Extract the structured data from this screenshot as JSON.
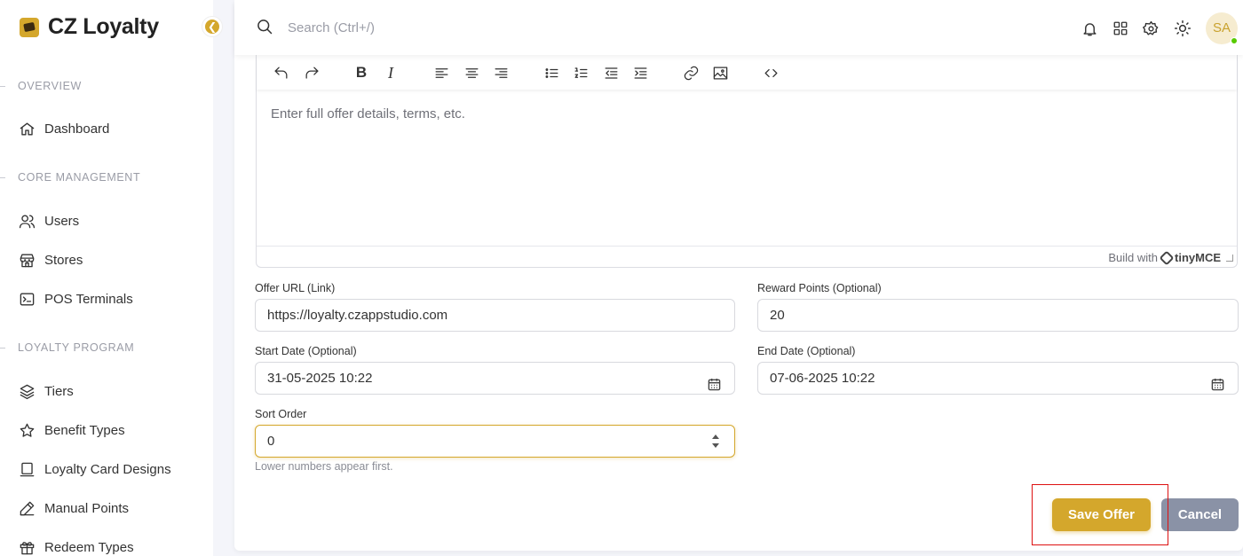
{
  "brand": {
    "name": "CZ Loyalty"
  },
  "sidebar": {
    "sections": {
      "overview": "OVERVIEW",
      "core": "CORE MANAGEMENT",
      "loyalty": "LOYALTY PROGRAM"
    },
    "items": [
      {
        "label": "Dashboard",
        "icon": "home-icon"
      },
      {
        "label": "Users",
        "icon": "users-icon"
      },
      {
        "label": "Stores",
        "icon": "store-icon"
      },
      {
        "label": "POS Terminals",
        "icon": "terminal-icon"
      },
      {
        "label": "Tiers",
        "icon": "layers-icon"
      },
      {
        "label": "Benefit Types",
        "icon": "star-icon"
      },
      {
        "label": "Loyalty Card Designs",
        "icon": "card-icon"
      },
      {
        "label": "Manual Points",
        "icon": "pencil-icon"
      },
      {
        "label": "Redeem Types",
        "icon": "gift-icon"
      }
    ]
  },
  "topbar": {
    "search_placeholder": "Search (Ctrl+/)",
    "avatar_initials": "SA"
  },
  "editor": {
    "placeholder": "Enter full offer details, terms, etc.",
    "branding_prefix": "Build with",
    "branding_name": "tinyMCE"
  },
  "form": {
    "offer_url": {
      "label": "Offer URL (Link)",
      "value": "https://loyalty.czappstudio.com"
    },
    "reward_points": {
      "label": "Reward Points (Optional)",
      "value": "20"
    },
    "start_date": {
      "label": "Start Date (Optional)",
      "value": "31-05-2025 10:22"
    },
    "end_date": {
      "label": "End Date (Optional)",
      "value": "07-06-2025 10:22"
    },
    "sort_order": {
      "label": "Sort Order",
      "value": "0",
      "hint": "Lower numbers appear first."
    }
  },
  "actions": {
    "save_label": "Save Offer",
    "cancel_label": "Cancel"
  },
  "colors": {
    "accent": "#d4a72c",
    "cancel": "#8a92a6",
    "highlight": "#dd1111"
  }
}
